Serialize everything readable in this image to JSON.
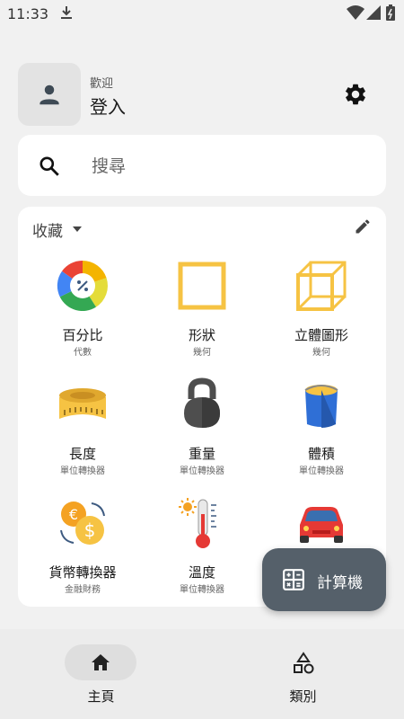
{
  "status_bar": {
    "time": "11:33"
  },
  "profile": {
    "greeting": "歡迎",
    "login_label": "登入"
  },
  "search": {
    "placeholder": "搜尋"
  },
  "favorites": {
    "title": "收藏",
    "items": [
      {
        "name": "百分比",
        "category": "代數",
        "icon": "percentage-icon"
      },
      {
        "name": "形狀",
        "category": "幾何",
        "icon": "square-shape-icon"
      },
      {
        "name": "立體圖形",
        "category": "幾何",
        "icon": "cube-icon"
      },
      {
        "name": "長度",
        "category": "單位轉換器",
        "icon": "tape-measure-icon"
      },
      {
        "name": "重量",
        "category": "單位轉換器",
        "icon": "kettlebell-icon"
      },
      {
        "name": "體積",
        "category": "單位轉換器",
        "icon": "paint-bucket-icon"
      },
      {
        "name": "貨幣轉換器",
        "category": "金融財務",
        "icon": "currency-exchange-icon"
      },
      {
        "name": "溫度",
        "category": "單位轉換器",
        "icon": "thermometer-icon"
      },
      {
        "name": "",
        "category": "",
        "icon": "car-icon"
      }
    ]
  },
  "fab": {
    "label": "計算機",
    "icon": "calculator-icon"
  },
  "bottom_nav": {
    "items": [
      {
        "label": "主頁",
        "icon": "home-icon",
        "active": true
      },
      {
        "label": "類別",
        "icon": "shapes-icon",
        "active": false
      }
    ]
  },
  "colors": {
    "background": "#f1f1f1",
    "card": "#ffffff",
    "fab": "#55606a",
    "nav_bar": "#ececec",
    "nav_active_pill": "#dedede",
    "accent_yellow": "#f6c343"
  }
}
